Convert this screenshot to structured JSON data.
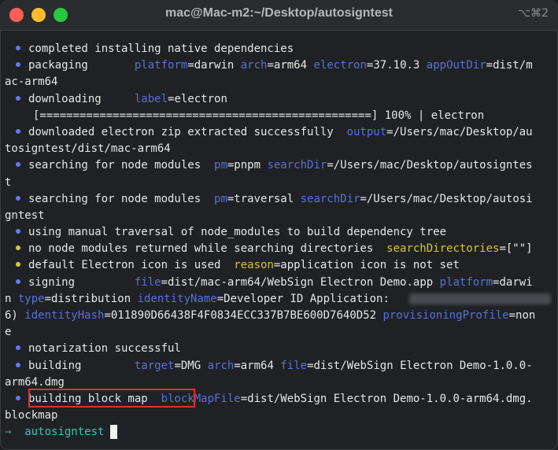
{
  "window": {
    "title": "mac@Mac-m2:~/Desktop/autosigntest",
    "shortcut": "⌥⌘2"
  },
  "terminal": {
    "l1": "completed installing native dependencies",
    "l2": {
      "label": "packaging",
      "k1": "platform",
      "v1": "=darwin ",
      "k2": "arch",
      "v2": "=arm64 ",
      "k3": "electron",
      "v3": "=37.10.3 ",
      "k4": "appOutDir",
      "v4": "=dist/m"
    },
    "l2b": "ac-arm64",
    "l3": {
      "label": "downloading",
      "k1": "label",
      "v1": "=electron"
    },
    "l4": "[==================================================] 100% | electron",
    "l5": {
      "text": "downloaded electron zip extracted successfully  ",
      "k1": "output",
      "v1": "=/Users/mac/Desktop/au"
    },
    "l5b": "tosigntest/dist/mac-arm64",
    "l6": {
      "text": "searching for node modules  ",
      "k1": "pm",
      "v1": "=pnpm ",
      "k2": "searchDir",
      "v2": "=/Users/mac/Desktop/autosigntes"
    },
    "l6b": "t",
    "l7": {
      "text": "searching for node modules  ",
      "k1": "pm",
      "v1": "=traversal ",
      "k2": "searchDir",
      "v2": "=/Users/mac/Desktop/autosi"
    },
    "l7b": "gntest",
    "l8": "using manual traversal of node_modules to build dependency tree",
    "l9": {
      "text": "no node modules returned while searching directories  ",
      "k1": "searchDirectories",
      "v1": "=[\"\"]"
    },
    "l10": {
      "text": "default Electron icon is used  ",
      "k1": "reason",
      "v1": "=application icon is not set"
    },
    "l11": {
      "label": "signing",
      "k1": "file",
      "v1": "=dist/mac-arm64/WebSign Electron Demo.app ",
      "k2": "platform",
      "v2": "=darwi"
    },
    "l11b": {
      "pre": "n ",
      "k1": "type",
      "v1": "=distribution ",
      "k2": "identityName",
      "v2": "=Developer ID Application: "
    },
    "l11c": {
      "pre": "6) ",
      "k1": "identityHash",
      "v1": "=011890D66438F4F0834ECC337B7BE600D7640D52 ",
      "k2": "provisioningProfile",
      "v2": "=non"
    },
    "l11d": "e",
    "l12": "notarization successful",
    "l13": {
      "label": "building",
      "k1": "target",
      "v1": "=DMG ",
      "k2": "arch",
      "v2": "=arm64 ",
      "k3": "file",
      "v3": "=dist/WebSign Electron Demo-1.0.0-"
    },
    "l13b": "arm64.dmg",
    "l14": {
      "label": "building block map  ",
      "k1": "blockMapFile",
      "v1": "=dist/WebSign Electron Demo-1.0.0-arm64.dmg."
    },
    "l14b": "blockmap",
    "prompt": {
      "arrow": "→",
      "dir": "autosigntest"
    }
  },
  "colors": {
    "info_bullet": "#5b7cf4",
    "warn_bullet": "#d7c73a",
    "key": "#5571d8",
    "prompt": "#3ac2b6",
    "highlight": "#e03030"
  }
}
